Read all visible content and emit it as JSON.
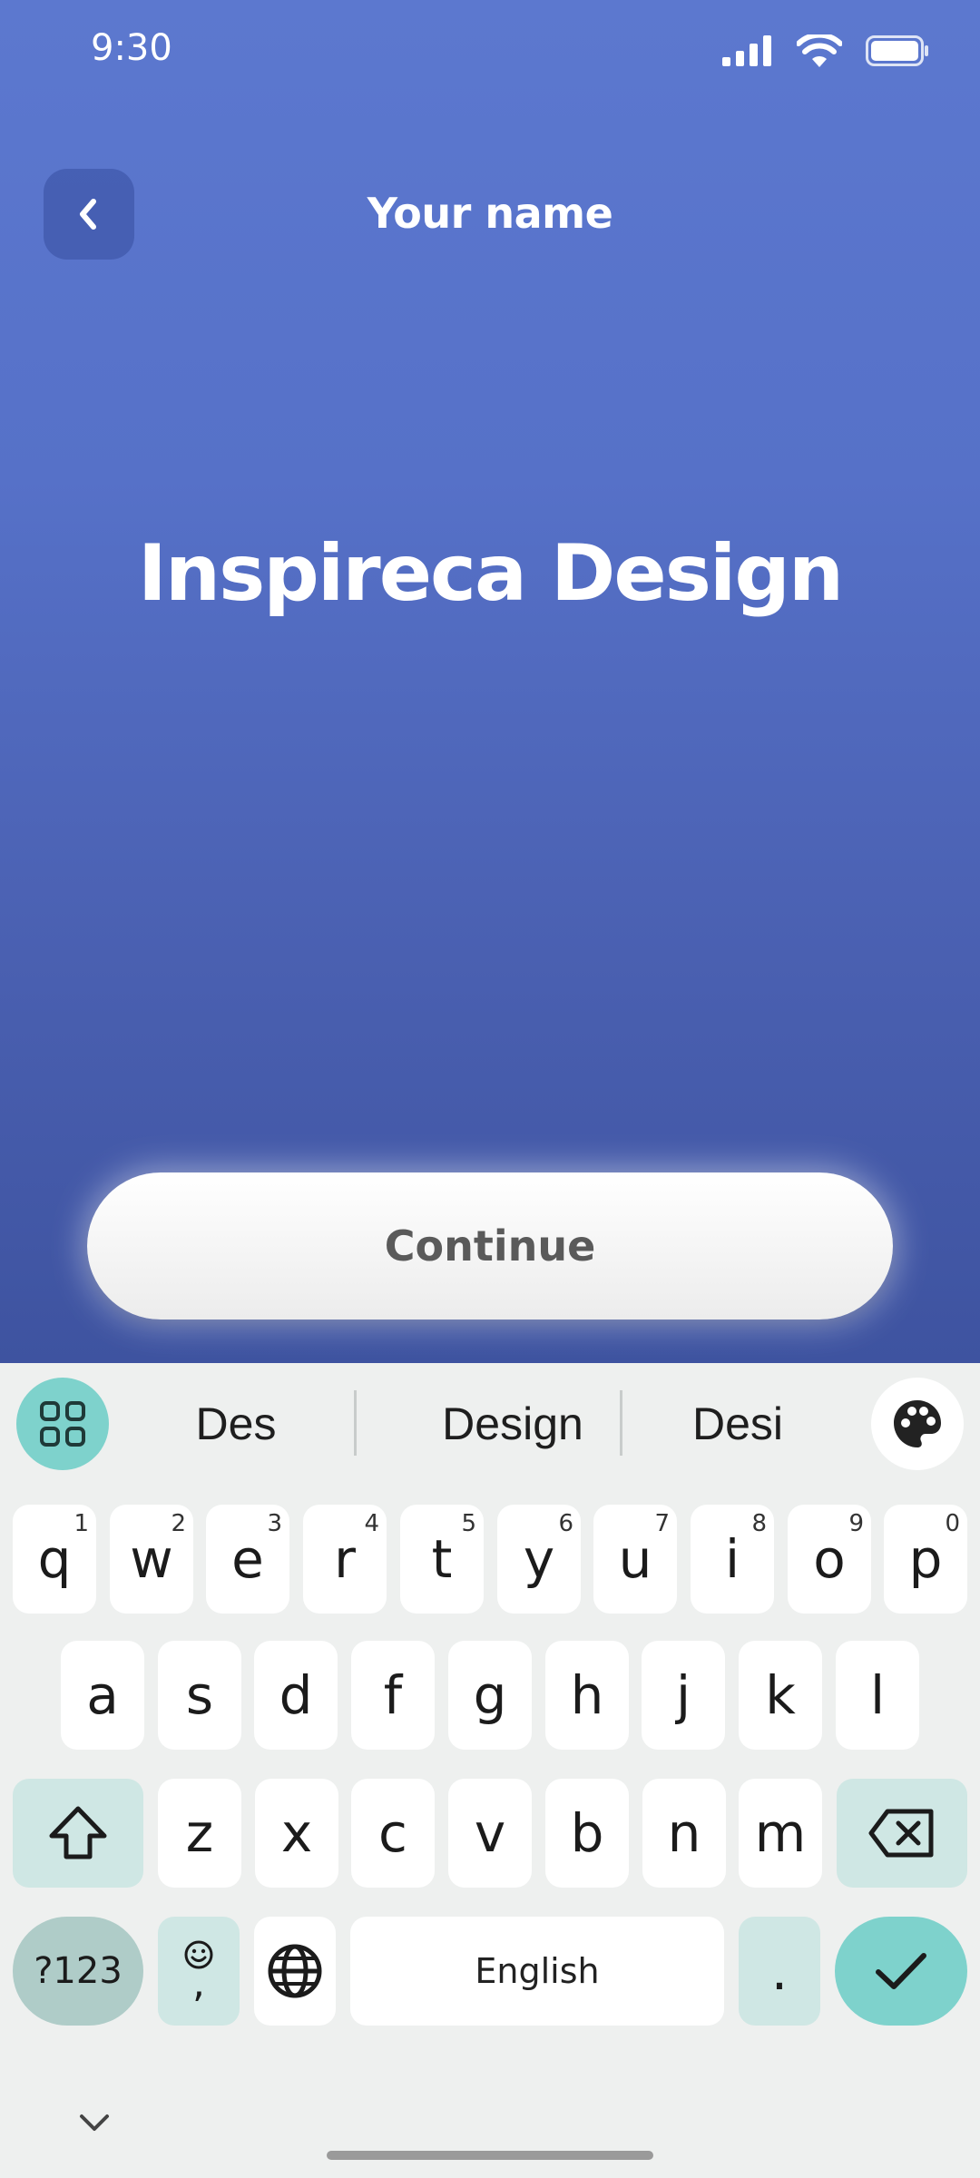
{
  "status_bar": {
    "time": "9:30",
    "icons": [
      "signal-icon",
      "wifi-icon",
      "battery-icon"
    ]
  },
  "header": {
    "title": "Your name",
    "back_icon": "chevron-left-icon"
  },
  "main": {
    "name_value": "Inspireca Design",
    "continue_label": "Continue"
  },
  "keyboard": {
    "suggestions": [
      "Des",
      "Design",
      "Desi"
    ],
    "row1": [
      {
        "label": "q",
        "hint": "1"
      },
      {
        "label": "w",
        "hint": "2"
      },
      {
        "label": "e",
        "hint": "3"
      },
      {
        "label": "r",
        "hint": "4"
      },
      {
        "label": "t",
        "hint": "5"
      },
      {
        "label": "y",
        "hint": "6"
      },
      {
        "label": "u",
        "hint": "7"
      },
      {
        "label": "i",
        "hint": "8"
      },
      {
        "label": "o",
        "hint": "9"
      },
      {
        "label": "p",
        "hint": "0"
      }
    ],
    "row2": [
      "a",
      "s",
      "d",
      "f",
      "g",
      "h",
      "j",
      "k",
      "l"
    ],
    "row3": [
      "z",
      "x",
      "c",
      "v",
      "b",
      "n",
      "m"
    ],
    "symbols_label": "?123",
    "comma_label": ",",
    "space_label": "English",
    "period_label": ".",
    "colors": {
      "accent": "#7ed2cc",
      "modifier": "#cfe7e4",
      "symbols": "#afccc8",
      "background": "#eef0ef"
    }
  },
  "colors": {
    "hero_top": "#5c78cf",
    "hero_bottom": "#3e53a0",
    "button_text": "#5a5a5a"
  }
}
